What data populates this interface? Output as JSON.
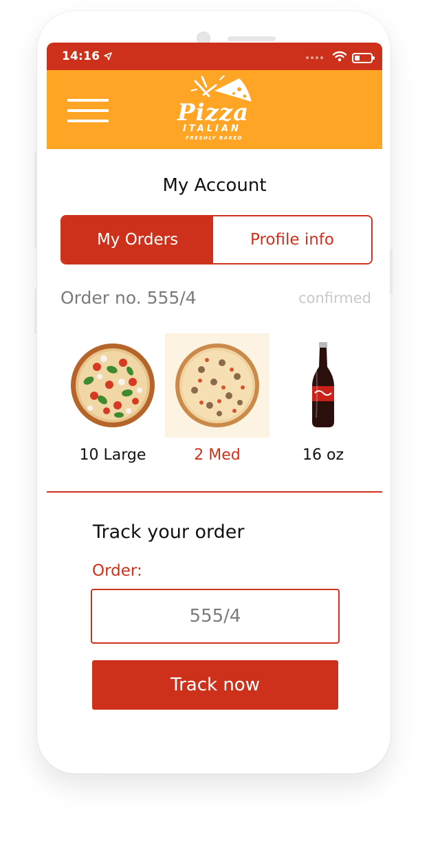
{
  "status_bar": {
    "time": "14:16",
    "location_icon": "location-arrow-icon",
    "signal_icon": "signal-dots-icon",
    "wifi_icon": "wifi-icon",
    "battery_icon": "battery-icon",
    "battery_level": 0.2
  },
  "header": {
    "menu_icon": "hamburger-menu-icon",
    "logo": {
      "word_main": "Pizza",
      "word_sub": "ITALIAN",
      "tagline": "FRESHLY BAKED"
    }
  },
  "page": {
    "title": "My Account"
  },
  "tabs": [
    {
      "label": "My Orders",
      "active": true
    },
    {
      "label": "Profile info",
      "active": false
    }
  ],
  "order": {
    "number_label": "Order no. 555/4",
    "status": "confirmed",
    "items": [
      {
        "image": "pizza-margherita-image",
        "label": "10 Large",
        "selected": false
      },
      {
        "image": "pizza-mushroom-image",
        "label": "2 Med",
        "selected": true
      },
      {
        "image": "cola-bottle-image",
        "label": "16 oz",
        "selected": false
      }
    ]
  },
  "track": {
    "title": "Track your order",
    "field_label": "Order:",
    "input_placeholder": "555/4",
    "input_value": "",
    "button_label": "Track now"
  },
  "colors": {
    "primary": "#cd311c",
    "header": "#fea526",
    "muted_text": "#7a7a7a",
    "status_text": "#c9c9c9"
  }
}
